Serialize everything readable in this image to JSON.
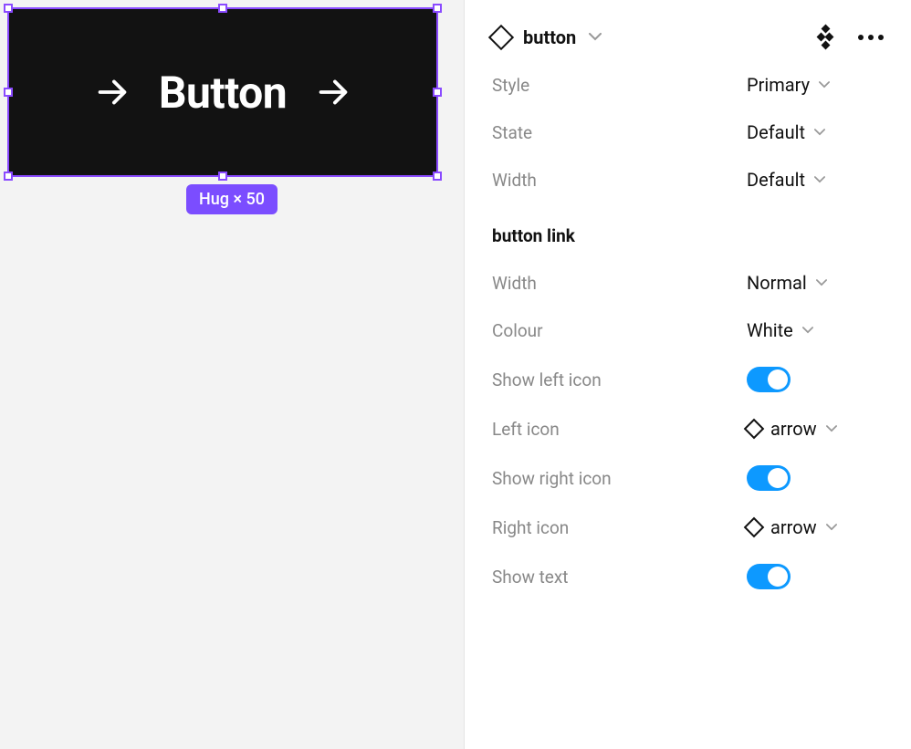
{
  "canvas": {
    "button_label": "Button",
    "size_badge": "Hug × 50"
  },
  "panel": {
    "component_name": "button",
    "props": {
      "style_label": "Style",
      "style_value": "Primary",
      "state_label": "State",
      "state_value": "Default",
      "width1_label": "Width",
      "width1_value": "Default"
    },
    "section_title": "button link",
    "link_props": {
      "width_label": "Width",
      "width_value": "Normal",
      "colour_label": "Colour",
      "colour_value": "White",
      "show_left_icon_label": "Show left icon",
      "left_icon_label": "Left icon",
      "left_icon_value": "arrow",
      "show_right_icon_label": "Show right icon",
      "right_icon_label": "Right icon",
      "right_icon_value": "arrow",
      "show_text_label": "Show text"
    }
  }
}
